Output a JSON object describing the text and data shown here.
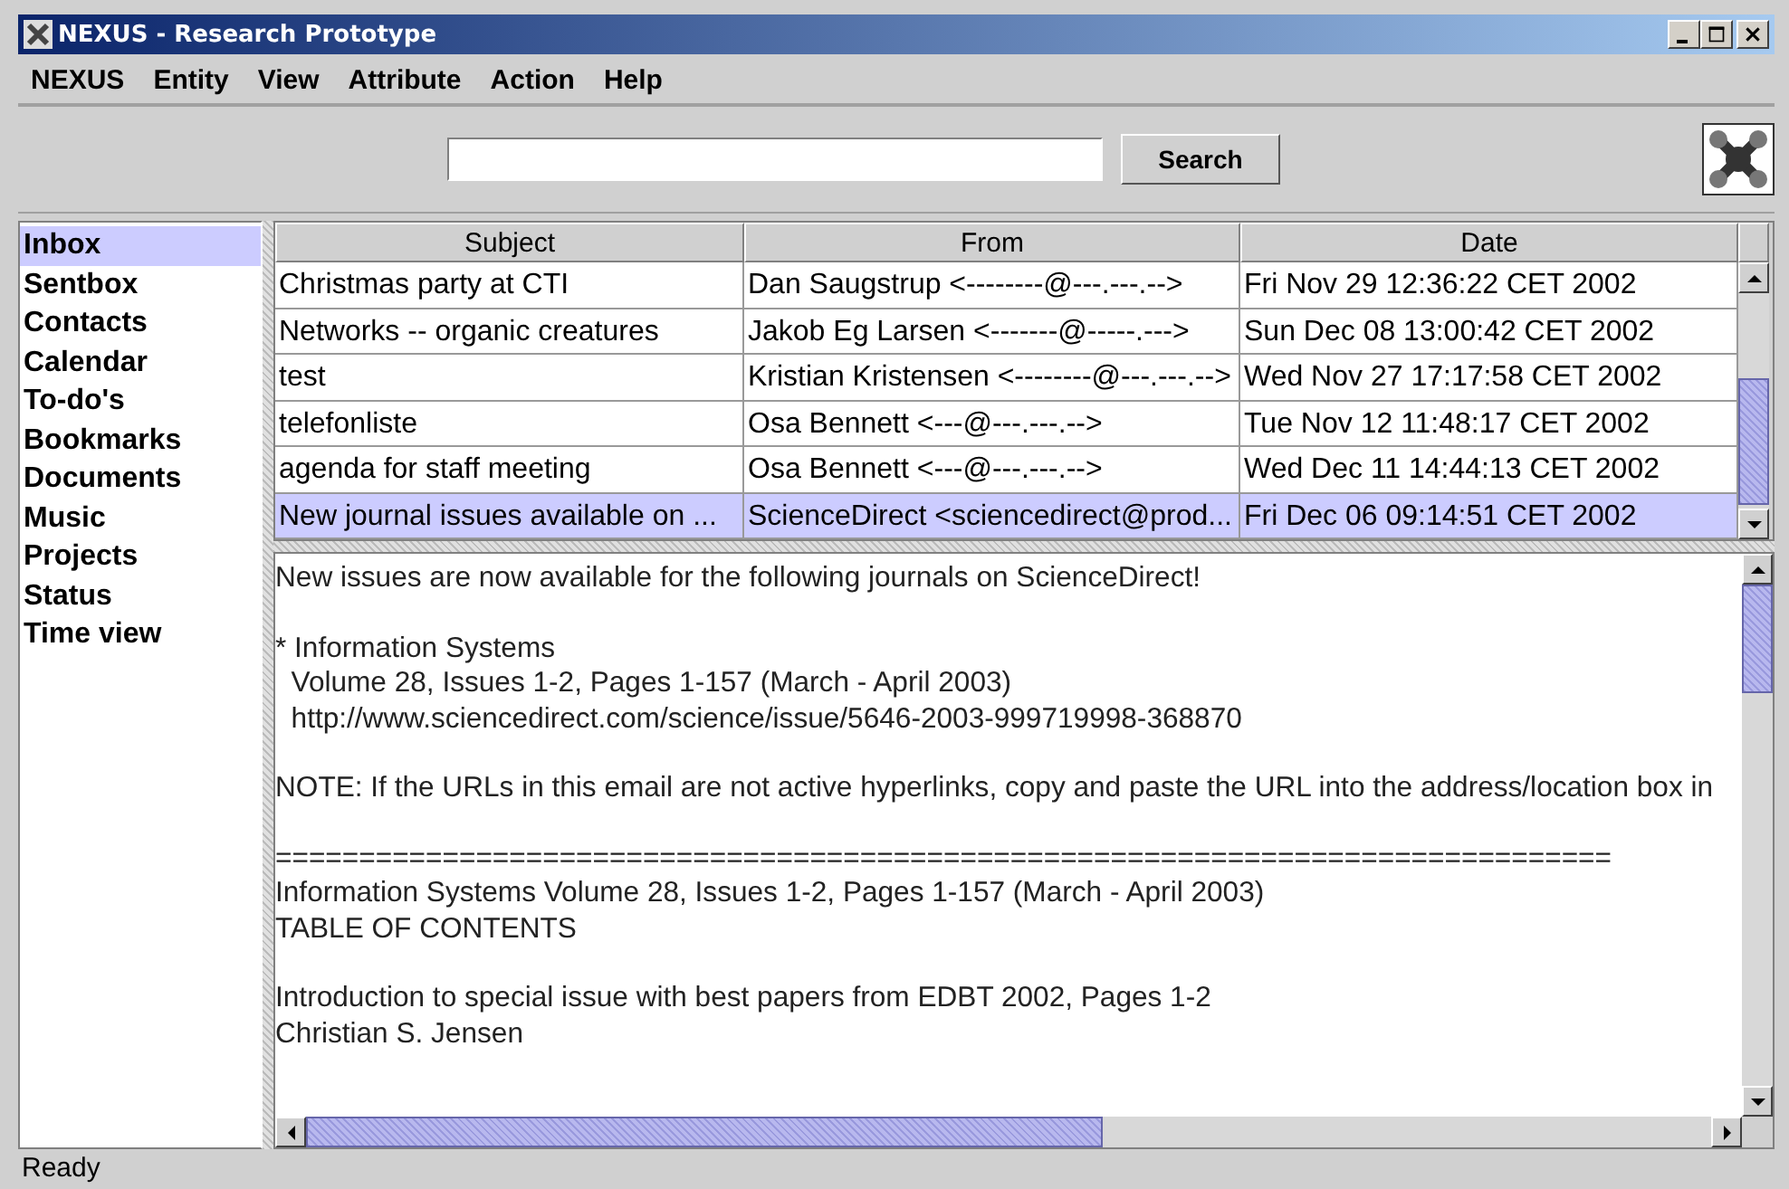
{
  "window": {
    "title": "NEXUS - Research Prototype"
  },
  "menu": [
    {
      "label": "NEXUS"
    },
    {
      "label": "Entity"
    },
    {
      "label": "View"
    },
    {
      "label": "Attribute"
    },
    {
      "label": "Action"
    },
    {
      "label": "Help"
    }
  ],
  "search": {
    "button": "Search"
  },
  "sidebar": {
    "items": [
      {
        "label": "Inbox",
        "selected": true
      },
      {
        "label": "Sentbox",
        "selected": false
      },
      {
        "label": "Contacts",
        "selected": false
      },
      {
        "label": "Calendar",
        "selected": false
      },
      {
        "label": "To-do's",
        "selected": false
      },
      {
        "label": "Bookmarks",
        "selected": false
      },
      {
        "label": "Documents",
        "selected": false
      },
      {
        "label": "Music",
        "selected": false
      },
      {
        "label": "Projects",
        "selected": false
      },
      {
        "label": "Status",
        "selected": false
      },
      {
        "label": "Time view",
        "selected": false
      }
    ]
  },
  "table": {
    "columns": [
      "Subject",
      "From",
      "Date"
    ],
    "rows": [
      {
        "cells": [
          "Christmas party at CTI",
          "Dan Saugstrup <--------@---.---.-->",
          "Fri Nov 29 12:36:22 CET 2002"
        ],
        "selected": false
      },
      {
        "cells": [
          "Networks -- organic creatures",
          "Jakob Eg Larsen <-------@-----.--->",
          "Sun Dec 08 13:00:42 CET 2002"
        ],
        "selected": false
      },
      {
        "cells": [
          "test",
          "Kristian Kristensen <--------@---.---.-->",
          "Wed Nov 27 17:17:58 CET 2002"
        ],
        "selected": false
      },
      {
        "cells": [
          "telefonliste",
          "Osa Bennett <---@---.---.-->",
          "Tue Nov 12 11:48:17 CET 2002"
        ],
        "selected": false
      },
      {
        "cells": [
          "agenda for staff meeting",
          "Osa Bennett <---@---.---.-->",
          "Wed Dec 11 14:44:13 CET 2002"
        ],
        "selected": false
      },
      {
        "cells": [
          "New journal issues available on ...",
          "ScienceDirect <sciencedirect@prod...",
          "Fri Dec 06 09:14:51 CET 2002"
        ],
        "selected": true
      }
    ]
  },
  "message": {
    "paragraphs": [
      [
        "New issues are now available for the following journals on ScienceDirect!"
      ],
      [
        "* Information Systems",
        "  Volume 28, Issues 1-2, Pages 1-157 (March - April 2003)",
        "  http://www.sciencedirect.com/science/issue/5646-2003-999719998-368870"
      ],
      [
        "NOTE: If the URLs in this email are not active hyperlinks, copy and paste the URL into the address/location box in"
      ],
      [
        "================================================================================",
        "Information Systems Volume 28, Issues 1-2, Pages 1-157 (March - April 2003)",
        "TABLE OF CONTENTS"
      ],
      [
        "Introduction to special issue with best papers from EDBT 2002, Pages 1-2",
        "Christian S. Jensen"
      ]
    ]
  },
  "status_bar": "Ready"
}
